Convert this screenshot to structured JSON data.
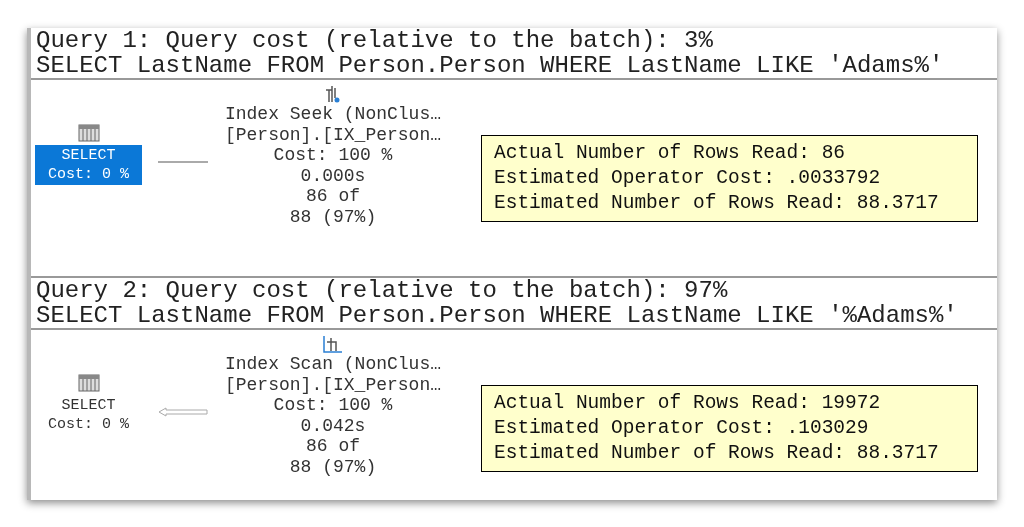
{
  "queries": [
    {
      "header": "Query 1: Query cost (relative to the batch): 3%",
      "sql": "SELECT LastName FROM Person.Person WHERE LastName LIKE 'Adams%'",
      "select_node": {
        "label": "SELECT",
        "cost": "Cost: 0 %",
        "selected": true
      },
      "connector": {
        "kind": "line"
      },
      "operator": {
        "kind": "seek",
        "lines": [
          "Index Seek (NonClus…",
          "[Person].[IX_Person…",
          "Cost: 100 %",
          "0.000s",
          "86 of",
          "88 (97%)"
        ]
      },
      "tooltip": [
        "Actual Number of Rows Read: 86",
        "Estimated Operator Cost: .0033792",
        "Estimated Number of Rows Read: 88.3717"
      ]
    },
    {
      "header": "Query 2: Query cost (relative to the batch): 97%",
      "sql": "SELECT LastName FROM Person.Person WHERE LastName LIKE '%Adams%'",
      "select_node": {
        "label": "SELECT",
        "cost": "Cost: 0 %",
        "selected": false
      },
      "connector": {
        "kind": "arrow"
      },
      "operator": {
        "kind": "scan",
        "lines": [
          "Index Scan (NonClus…",
          "[Person].[IX_Person…",
          "Cost: 100 %",
          "0.042s",
          "86 of",
          "88 (97%)"
        ]
      },
      "tooltip": [
        "Actual Number of Rows Read: 19972",
        "Estimated Operator Cost: .103029",
        "Estimated Number of Rows Read: 88.3717"
      ]
    }
  ]
}
